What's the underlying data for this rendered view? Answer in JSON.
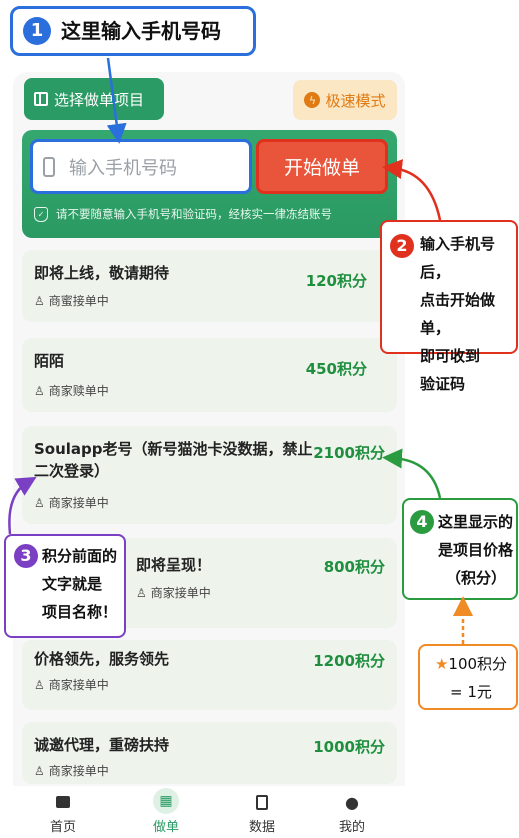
{
  "callout1": {
    "number": "1",
    "text": "这里输入手机号码"
  },
  "toolbar": {
    "select_label": "选择做单项目",
    "fast_label": "极速模式"
  },
  "input": {
    "placeholder": "输入手机号码"
  },
  "start_button": "开始做单",
  "warning": "请不要随意输入手机号和验证码，经核实一律冻结账号",
  "projects": [
    {
      "name": "即将上线，敬请期待",
      "status": "商蜜接单中",
      "price": "120积分"
    },
    {
      "name": "陌陌",
      "status": "商家赎单中",
      "price": "450积分"
    },
    {
      "name": "Soulapp老号（新号猫池卡没数据，禁止二次登录）",
      "status": "商家接单中",
      "price": "2100积分"
    },
    {
      "name": "即将呈现！",
      "status": "商家接单中",
      "price": "800积分"
    },
    {
      "name": "价格领先，服务领先",
      "status": "商家接单中",
      "price": "1200积分"
    },
    {
      "name": "诚邀代理，重磅扶持",
      "status": "商家接单中",
      "price": "1000积分"
    }
  ],
  "callout2": {
    "number": "2",
    "lines": [
      "输入手机号后，",
      "点击开始做单，",
      "即可收到",
      "验证码"
    ]
  },
  "callout3": {
    "number": "3",
    "lines": [
      "积分前面的",
      "文字就是",
      "项目名称！"
    ]
  },
  "callout4": {
    "number": "4",
    "lines": [
      "这里显示的",
      "是项目价格",
      "（积分）"
    ]
  },
  "callout5": {
    "lines": [
      "★100积分",
      "= 1元"
    ]
  },
  "tabs": [
    {
      "label": "首页"
    },
    {
      "label": "做单"
    },
    {
      "label": "数据"
    },
    {
      "label": "我的"
    }
  ],
  "colors": {
    "green": "#2a9b64",
    "blue": "#2a6fdb",
    "red": "#e0301e",
    "purple": "#7b3fc4",
    "orange": "#f08a24"
  }
}
